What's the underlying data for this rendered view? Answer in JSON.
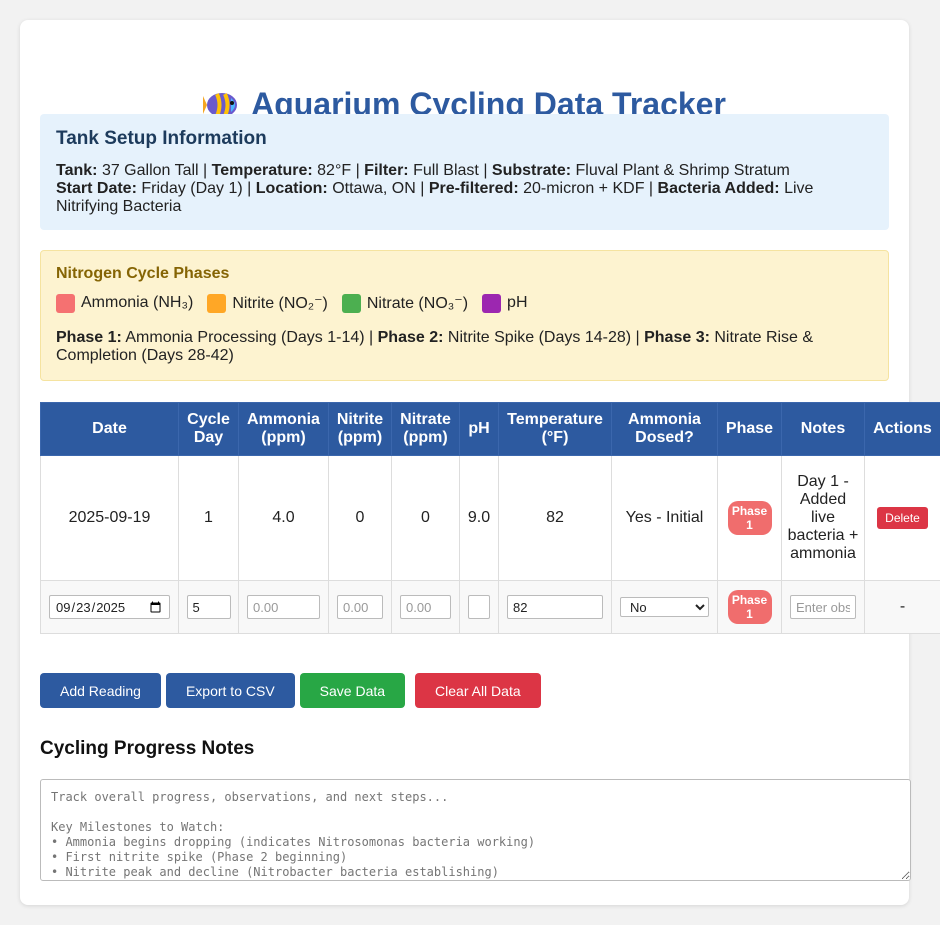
{
  "title": "Aquarium Cycling Data Tracker",
  "setup": {
    "heading": "Tank Setup Information",
    "tank_label": "Tank:",
    "tank": "37 Gallon Tall",
    "temp_label": "Temperature:",
    "temp": "82°F",
    "filter_label": "Filter:",
    "filter": "Full Blast",
    "substrate_label": "Substrate:",
    "substrate": "Fluval Plant & Shrimp Stratum",
    "start_label": "Start Date:",
    "start": "Friday (Day 1)",
    "location_label": "Location:",
    "location": "Ottawa, ON",
    "prefilter_label": "Pre-filtered:",
    "prefilter": "20-micron + KDF",
    "bacteria_label": "Bacteria Added:",
    "bacteria": "Live Nitrifying Bacteria"
  },
  "phases": {
    "heading": "Nitrogen Cycle Phases",
    "legend": [
      {
        "label": "Ammonia (NH₃)",
        "color": "#f57171"
      },
      {
        "label": "Nitrite (NO₂⁻)",
        "color": "#ffa726"
      },
      {
        "label": "Nitrate (NO₃⁻)",
        "color": "#4caf50"
      },
      {
        "label": "pH",
        "color": "#9c27b0"
      }
    ],
    "p1_label": "Phase 1:",
    "p1": "Ammonia Processing (Days 1-14)",
    "p2_label": "Phase 2:",
    "p2": "Nitrite Spike (Days 14-28)",
    "p3_label": "Phase 3:",
    "p3": "Nitrate Rise & Completion (Days 28-42)"
  },
  "table": {
    "headers": [
      "Date",
      "Cycle Day",
      "Ammonia (ppm)",
      "Nitrite (ppm)",
      "Nitrate (ppm)",
      "pH",
      "Temperature (°F)",
      "Ammonia Dosed?",
      "Phase",
      "Notes",
      "Actions"
    ],
    "row": {
      "date": "2025-09-19",
      "day": "1",
      "ammonia": "4.0",
      "nitrite": "0",
      "nitrate": "0",
      "ph": "9.0",
      "temp": "82",
      "dosed": "Yes - Initial",
      "phase": "Phase 1",
      "notes": "Day 1 - Added live bacteria + ammonia",
      "delete": "Delete"
    },
    "input": {
      "date": "2025-09-23",
      "day": "5",
      "ammonia_ph": "0.00",
      "nitrite_ph": "0.00",
      "nitrate_ph": "0.00",
      "ph": "",
      "temp": "82",
      "dosed": "No",
      "phase": "Phase 1",
      "notes_ph": "Enter observations...",
      "actions": "-"
    }
  },
  "buttons": {
    "add": "Add Reading",
    "export": "Export to CSV",
    "save": "Save Data",
    "clear": "Clear All Data"
  },
  "notes": {
    "heading": "Cycling Progress Notes",
    "placeholder": "Track overall progress, observations, and next steps...\n\nKey Milestones to Watch:\n• Ammonia begins dropping (indicates Nitrosomonas bacteria working)\n• First nitrite spike (Phase 2 beginning)\n• Nitrite peak and decline (Nitrobacter bacteria establishing)"
  }
}
